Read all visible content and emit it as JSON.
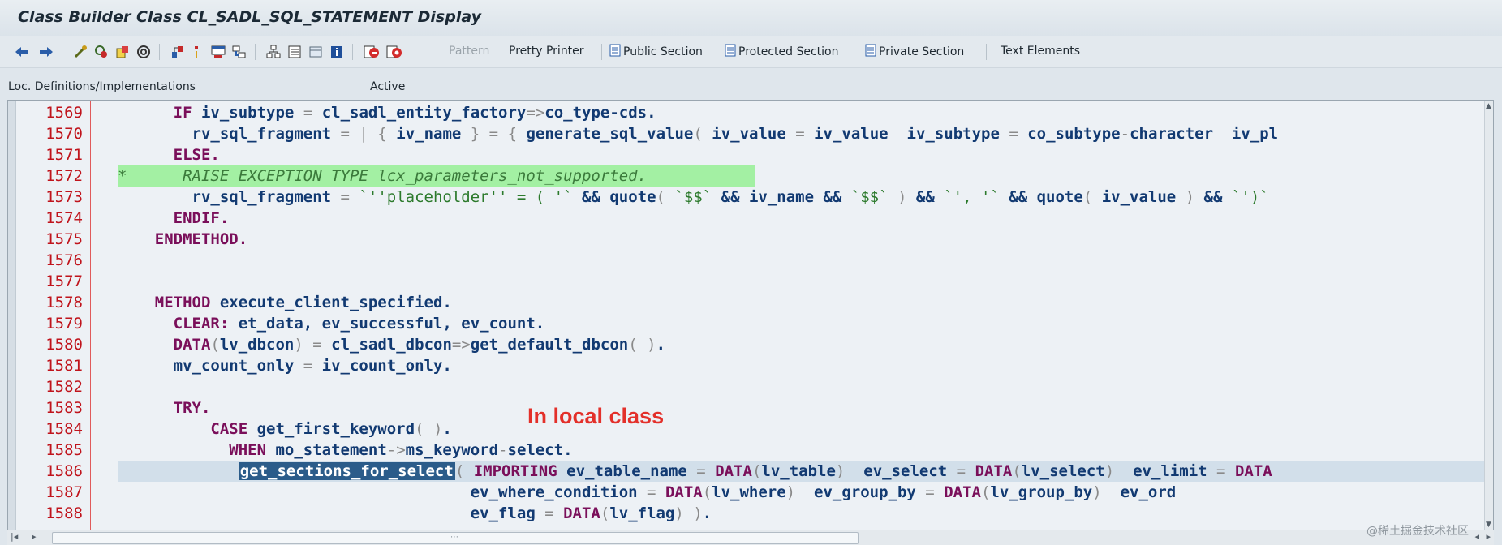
{
  "window": {
    "title": "Class Builder Class CL_SADL_SQL_STATEMENT Display"
  },
  "toolbar": {
    "icons": [
      "back-arrow-icon",
      "forward-arrow-icon",
      "other-object-icon",
      "display-change-icon",
      "active-inactive-icon",
      "check-icon",
      "activate-icon",
      "where-used-icon",
      "object-list-icon",
      "display-navigation-window-icon",
      "enhance-icon",
      "class-hierarchy-icon",
      "signature-icon",
      "object-info-icon",
      "breakpoint-icon",
      "session-breakpoint-icon"
    ],
    "pattern": "Pattern",
    "pretty_printer": "Pretty Printer",
    "public_section": "Public Section",
    "protected_section": "Protected Section",
    "private_section": "Private Section",
    "text_elements": "Text Elements"
  },
  "status": {
    "loc": "Loc. Definitions/Implementations",
    "active": "Active"
  },
  "editor": {
    "line_numbers": [
      "1569",
      "1570",
      "1571",
      "1572",
      "1573",
      "1574",
      "1575",
      "1576",
      "1577",
      "1578",
      "1579",
      "1580",
      "1581",
      "1582",
      "1583",
      "1584",
      "1585",
      "1586",
      "1587",
      "1588"
    ]
  },
  "annotation": "In local class",
  "watermark": "@稀土掘金技术社区"
}
